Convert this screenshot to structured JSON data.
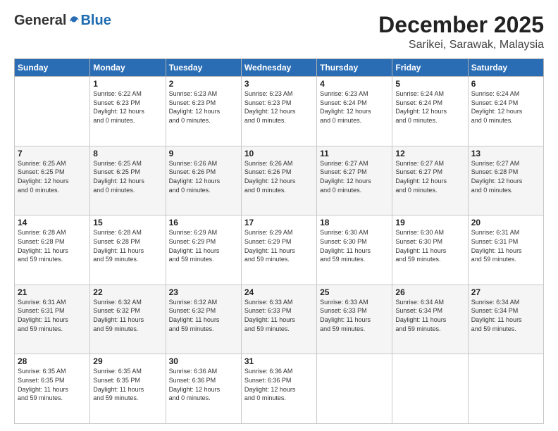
{
  "logo": {
    "general": "General",
    "blue": "Blue"
  },
  "title": "December 2025",
  "location": "Sarikei, Sarawak, Malaysia",
  "days_of_week": [
    "Sunday",
    "Monday",
    "Tuesday",
    "Wednesday",
    "Thursday",
    "Friday",
    "Saturday"
  ],
  "weeks": [
    [
      {
        "day": "",
        "info": ""
      },
      {
        "day": "1",
        "info": "Sunrise: 6:22 AM\nSunset: 6:23 PM\nDaylight: 12 hours\nand 0 minutes."
      },
      {
        "day": "2",
        "info": "Sunrise: 6:23 AM\nSunset: 6:23 PM\nDaylight: 12 hours\nand 0 minutes."
      },
      {
        "day": "3",
        "info": "Sunrise: 6:23 AM\nSunset: 6:23 PM\nDaylight: 12 hours\nand 0 minutes."
      },
      {
        "day": "4",
        "info": "Sunrise: 6:23 AM\nSunset: 6:24 PM\nDaylight: 12 hours\nand 0 minutes."
      },
      {
        "day": "5",
        "info": "Sunrise: 6:24 AM\nSunset: 6:24 PM\nDaylight: 12 hours\nand 0 minutes."
      },
      {
        "day": "6",
        "info": "Sunrise: 6:24 AM\nSunset: 6:24 PM\nDaylight: 12 hours\nand 0 minutes."
      }
    ],
    [
      {
        "day": "7",
        "info": "Sunrise: 6:25 AM\nSunset: 6:25 PM\nDaylight: 12 hours\nand 0 minutes."
      },
      {
        "day": "8",
        "info": "Sunrise: 6:25 AM\nSunset: 6:25 PM\nDaylight: 12 hours\nand 0 minutes."
      },
      {
        "day": "9",
        "info": "Sunrise: 6:26 AM\nSunset: 6:26 PM\nDaylight: 12 hours\nand 0 minutes."
      },
      {
        "day": "10",
        "info": "Sunrise: 6:26 AM\nSunset: 6:26 PM\nDaylight: 12 hours\nand 0 minutes."
      },
      {
        "day": "11",
        "info": "Sunrise: 6:27 AM\nSunset: 6:27 PM\nDaylight: 12 hours\nand 0 minutes."
      },
      {
        "day": "12",
        "info": "Sunrise: 6:27 AM\nSunset: 6:27 PM\nDaylight: 12 hours\nand 0 minutes."
      },
      {
        "day": "13",
        "info": "Sunrise: 6:27 AM\nSunset: 6:28 PM\nDaylight: 12 hours\nand 0 minutes."
      }
    ],
    [
      {
        "day": "14",
        "info": "Sunrise: 6:28 AM\nSunset: 6:28 PM\nDaylight: 11 hours\nand 59 minutes."
      },
      {
        "day": "15",
        "info": "Sunrise: 6:28 AM\nSunset: 6:28 PM\nDaylight: 11 hours\nand 59 minutes."
      },
      {
        "day": "16",
        "info": "Sunrise: 6:29 AM\nSunset: 6:29 PM\nDaylight: 11 hours\nand 59 minutes."
      },
      {
        "day": "17",
        "info": "Sunrise: 6:29 AM\nSunset: 6:29 PM\nDaylight: 11 hours\nand 59 minutes."
      },
      {
        "day": "18",
        "info": "Sunrise: 6:30 AM\nSunset: 6:30 PM\nDaylight: 11 hours\nand 59 minutes."
      },
      {
        "day": "19",
        "info": "Sunrise: 6:30 AM\nSunset: 6:30 PM\nDaylight: 11 hours\nand 59 minutes."
      },
      {
        "day": "20",
        "info": "Sunrise: 6:31 AM\nSunset: 6:31 PM\nDaylight: 11 hours\nand 59 minutes."
      }
    ],
    [
      {
        "day": "21",
        "info": "Sunrise: 6:31 AM\nSunset: 6:31 PM\nDaylight: 11 hours\nand 59 minutes."
      },
      {
        "day": "22",
        "info": "Sunrise: 6:32 AM\nSunset: 6:32 PM\nDaylight: 11 hours\nand 59 minutes."
      },
      {
        "day": "23",
        "info": "Sunrise: 6:32 AM\nSunset: 6:32 PM\nDaylight: 11 hours\nand 59 minutes."
      },
      {
        "day": "24",
        "info": "Sunrise: 6:33 AM\nSunset: 6:33 PM\nDaylight: 11 hours\nand 59 minutes."
      },
      {
        "day": "25",
        "info": "Sunrise: 6:33 AM\nSunset: 6:33 PM\nDaylight: 11 hours\nand 59 minutes."
      },
      {
        "day": "26",
        "info": "Sunrise: 6:34 AM\nSunset: 6:34 PM\nDaylight: 11 hours\nand 59 minutes."
      },
      {
        "day": "27",
        "info": "Sunrise: 6:34 AM\nSunset: 6:34 PM\nDaylight: 11 hours\nand 59 minutes."
      }
    ],
    [
      {
        "day": "28",
        "info": "Sunrise: 6:35 AM\nSunset: 6:35 PM\nDaylight: 11 hours\nand 59 minutes."
      },
      {
        "day": "29",
        "info": "Sunrise: 6:35 AM\nSunset: 6:35 PM\nDaylight: 11 hours\nand 59 minutes."
      },
      {
        "day": "30",
        "info": "Sunrise: 6:36 AM\nSunset: 6:36 PM\nDaylight: 12 hours\nand 0 minutes."
      },
      {
        "day": "31",
        "info": "Sunrise: 6:36 AM\nSunset: 6:36 PM\nDaylight: 12 hours\nand 0 minutes."
      },
      {
        "day": "",
        "info": ""
      },
      {
        "day": "",
        "info": ""
      },
      {
        "day": "",
        "info": ""
      }
    ]
  ]
}
